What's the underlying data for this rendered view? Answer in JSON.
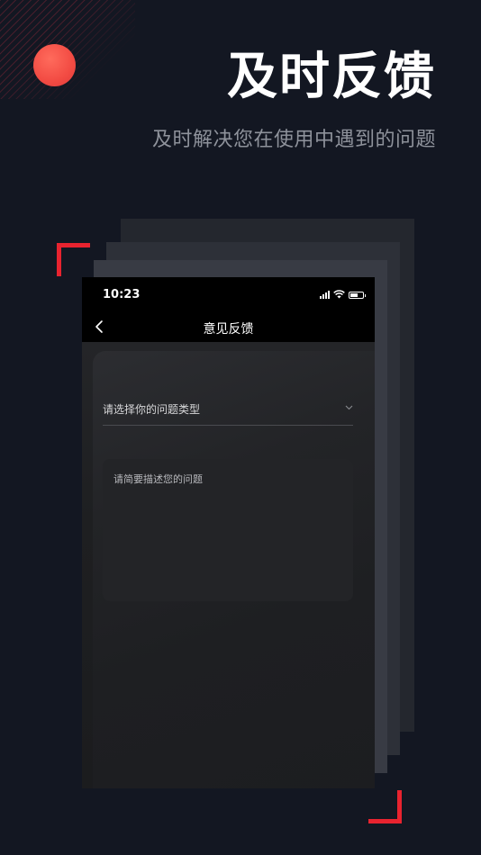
{
  "promo": {
    "headline": "及时反馈",
    "subline": "及时解决您在使用中遇到的问题",
    "accent_color": "#e8232f",
    "dot_color": "#f24b43"
  },
  "status_bar": {
    "time": "10:23",
    "icons": [
      "signal-icon",
      "wifi-icon",
      "battery-icon"
    ],
    "battery_level": 0.6
  },
  "nav": {
    "title": "意见反馈",
    "back_icon": "chevron-left-icon"
  },
  "form": {
    "type_select": {
      "placeholder": "请选择你的问题类型",
      "icon": "chevron-down-icon"
    },
    "description": {
      "placeholder": "请简要描述您的问题"
    }
  }
}
